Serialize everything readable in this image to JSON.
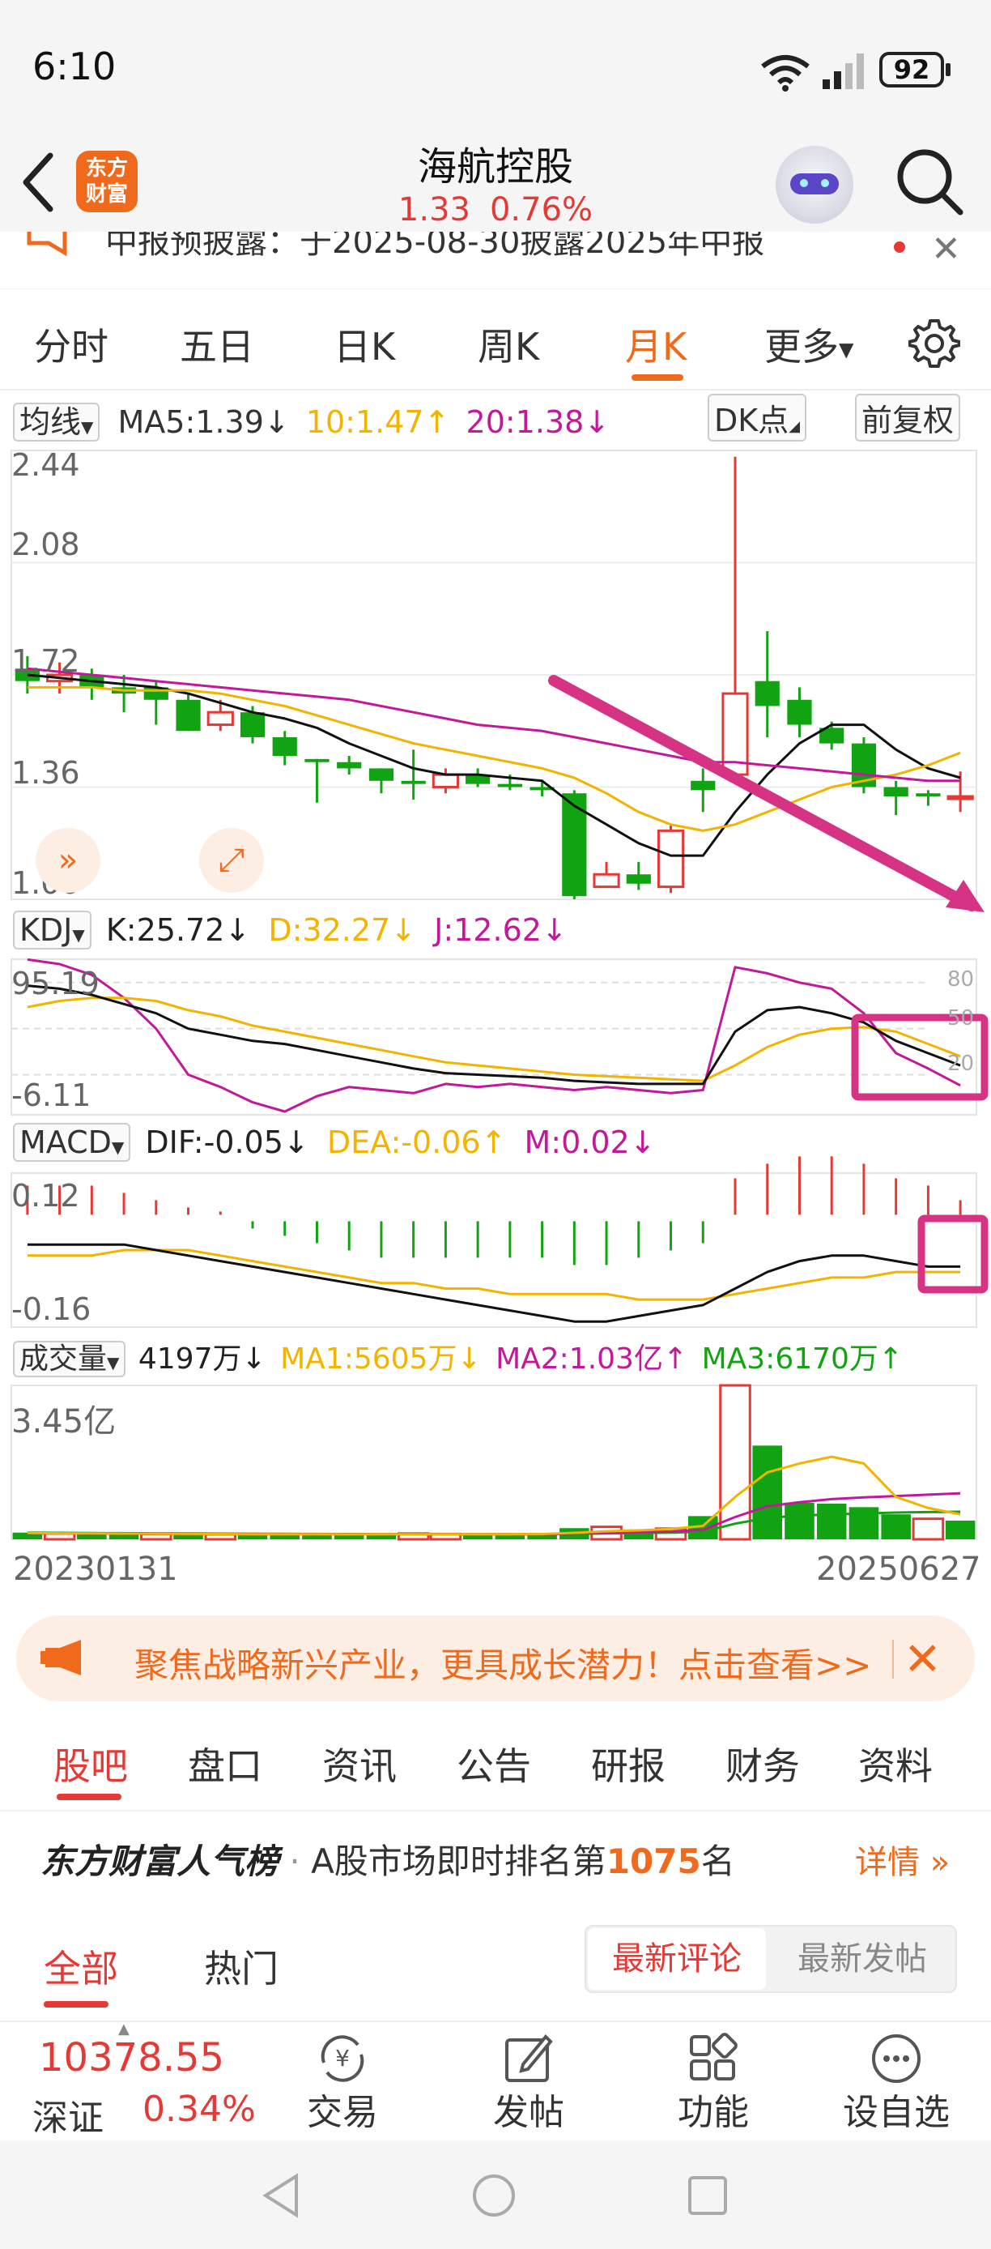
{
  "status_bar": {
    "time": "6:10",
    "battery": "92"
  },
  "header": {
    "logo_text": "东方\n财富",
    "stock_name": "海航控股",
    "price": "1.33",
    "change_pct": "0.76%"
  },
  "notice": {
    "text": "中报预披露：于2025-08-30披露2025年中报"
  },
  "period_tabs": [
    "分时",
    "五日",
    "日K",
    "周K",
    "月K",
    "更多"
  ],
  "ma_row": {
    "selector": "均线",
    "ma5": "MA5:1.39",
    "ma10": "10:1.47",
    "ma20": "20:1.38",
    "dk_button": "DK点",
    "adjust_button": "前复权"
  },
  "price_chart": {
    "y_labels": [
      "2.44",
      "2.08",
      "1.72",
      "1.36",
      "1.00"
    ]
  },
  "kdj_row": {
    "selector": "KDJ",
    "k": "K:25.72",
    "d": "D:32.27",
    "j": "J:12.62"
  },
  "kdj_chart": {
    "y_max": "95.19",
    "y_min": "-6.11",
    "right_labels": [
      "80",
      "50",
      "20"
    ]
  },
  "macd_row": {
    "selector": "MACD",
    "dif": "DIF:-0.05",
    "dea": "DEA:-0.06",
    "m": "M:0.02"
  },
  "macd_chart": {
    "y_max": "0.12",
    "y_min": "-0.16"
  },
  "vol_row": {
    "selector": "成交量",
    "vol": "4197万",
    "ma1": "MA1:5605万",
    "ma2": "MA2:1.03亿",
    "ma3": "MA3:6170万"
  },
  "vol_chart": {
    "y_max": "3.45亿"
  },
  "date_range": {
    "start": "20230131",
    "end": "20250627"
  },
  "banner": {
    "text": "聚焦战略新兴产业，更具成长潜力！点击查看>>"
  },
  "content_tabs": [
    "股吧",
    "盘口",
    "资讯",
    "公告",
    "研报",
    "财务",
    "资料"
  ],
  "popularity": {
    "brand": "东方财富人气榜",
    "prefix": "A股市场即时排名第",
    "rank": "1075",
    "suffix": "名",
    "detail": "详情"
  },
  "filter_tabs": [
    "全部",
    "热门"
  ],
  "sort_options": [
    "最新评论",
    "最新发帖"
  ],
  "bottom_index": {
    "value": "10378.55",
    "name": "深证",
    "change": "0.34%"
  },
  "bottom_bar": [
    "交易",
    "发帖",
    "功能",
    "设自选"
  ],
  "colors": {
    "up": "#e53935",
    "down": "#12a312",
    "accent": "#f06a1e",
    "ma10": "#f2b400",
    "ma20": "#c2189a",
    "annotation": "#d63384"
  },
  "chart_data": [
    {
      "type": "candlestick",
      "period": "monthly",
      "ylim": [
        1.0,
        2.44
      ],
      "candles": [
        {
          "o": 1.74,
          "c": 1.7,
          "h": 1.78,
          "l": 1.66
        },
        {
          "o": 1.7,
          "c": 1.72,
          "h": 1.76,
          "l": 1.66
        },
        {
          "o": 1.72,
          "c": 1.68,
          "h": 1.74,
          "l": 1.64
        },
        {
          "o": 1.68,
          "c": 1.66,
          "h": 1.72,
          "l": 1.6
        },
        {
          "o": 1.68,
          "c": 1.64,
          "h": 1.7,
          "l": 1.56
        },
        {
          "o": 1.64,
          "c": 1.54,
          "h": 1.66,
          "l": 1.54
        },
        {
          "o": 1.56,
          "c": 1.6,
          "h": 1.64,
          "l": 1.54
        },
        {
          "o": 1.6,
          "c": 1.52,
          "h": 1.62,
          "l": 1.5
        },
        {
          "o": 1.52,
          "c": 1.46,
          "h": 1.54,
          "l": 1.43
        },
        {
          "o": 1.45,
          "c": 1.44,
          "h": 1.45,
          "l": 1.31
        },
        {
          "o": 1.44,
          "c": 1.42,
          "h": 1.46,
          "l": 1.4
        },
        {
          "o": 1.42,
          "c": 1.38,
          "h": 1.42,
          "l": 1.34
        },
        {
          "o": 1.38,
          "c": 1.37,
          "h": 1.48,
          "l": 1.32
        },
        {
          "o": 1.36,
          "c": 1.4,
          "h": 1.42,
          "l": 1.34
        },
        {
          "o": 1.4,
          "c": 1.37,
          "h": 1.42,
          "l": 1.36
        },
        {
          "o": 1.37,
          "c": 1.36,
          "h": 1.4,
          "l": 1.35
        },
        {
          "o": 1.36,
          "c": 1.35,
          "h": 1.38,
          "l": 1.33
        },
        {
          "o": 1.34,
          "c": 1.01,
          "h": 1.35,
          "l": 1.0
        },
        {
          "o": 1.04,
          "c": 1.08,
          "h": 1.12,
          "l": 1.04
        },
        {
          "o": 1.08,
          "c": 1.05,
          "h": 1.12,
          "l": 1.03
        },
        {
          "o": 1.04,
          "c": 1.22,
          "h": 1.24,
          "l": 1.02
        },
        {
          "o": 1.38,
          "c": 1.35,
          "h": 1.42,
          "l": 1.28
        },
        {
          "o": 1.4,
          "c": 1.66,
          "h": 2.42,
          "l": 1.38
        },
        {
          "o": 1.7,
          "c": 1.62,
          "h": 1.86,
          "l": 1.52
        },
        {
          "o": 1.64,
          "c": 1.56,
          "h": 1.68,
          "l": 1.52
        },
        {
          "o": 1.55,
          "c": 1.5,
          "h": 1.57,
          "l": 1.48
        },
        {
          "o": 1.5,
          "c": 1.36,
          "h": 1.52,
          "l": 1.34
        },
        {
          "o": 1.36,
          "c": 1.33,
          "h": 1.38,
          "l": 1.27
        },
        {
          "o": 1.34,
          "c": 1.33,
          "h": 1.35,
          "l": 1.3
        },
        {
          "o": 1.33,
          "c": 1.33,
          "h": 1.41,
          "l": 1.28
        }
      ],
      "ma5": [
        1.72,
        1.71,
        1.7,
        1.69,
        1.68,
        1.66,
        1.63,
        1.6,
        1.58,
        1.55,
        1.5,
        1.46,
        1.42,
        1.4,
        1.4,
        1.39,
        1.38,
        1.3,
        1.24,
        1.18,
        1.14,
        1.14,
        1.28,
        1.4,
        1.5,
        1.56,
        1.56,
        1.48,
        1.42,
        1.39
      ],
      "ma10": [
        1.68,
        1.68,
        1.68,
        1.67,
        1.67,
        1.67,
        1.66,
        1.64,
        1.62,
        1.59,
        1.56,
        1.53,
        1.5,
        1.48,
        1.46,
        1.44,
        1.42,
        1.39,
        1.34,
        1.28,
        1.24,
        1.22,
        1.24,
        1.28,
        1.32,
        1.36,
        1.38,
        1.4,
        1.43,
        1.47
      ],
      "ma20": [
        1.74,
        1.73,
        1.72,
        1.71,
        1.7,
        1.69,
        1.68,
        1.67,
        1.66,
        1.65,
        1.64,
        1.62,
        1.6,
        1.58,
        1.56,
        1.55,
        1.54,
        1.52,
        1.5,
        1.48,
        1.46,
        1.44,
        1.44,
        1.43,
        1.42,
        1.41,
        1.4,
        1.39,
        1.38,
        1.38
      ]
    },
    {
      "type": "line",
      "name": "KDJ",
      "ylim": [
        -6.11,
        95.19
      ],
      "K": [
        78,
        76,
        72,
        66,
        60,
        50,
        46,
        42,
        40,
        36,
        32,
        28,
        24,
        21,
        20,
        19,
        18,
        16,
        15,
        14,
        14,
        14,
        48,
        62,
        64,
        60,
        54,
        42,
        34,
        26
      ],
      "D": [
        64,
        68,
        70,
        70,
        68,
        62,
        58,
        52,
        48,
        44,
        40,
        36,
        32,
        28,
        26,
        24,
        22,
        20,
        19,
        18,
        17,
        16,
        26,
        38,
        46,
        50,
        51,
        48,
        40,
        32
      ],
      "J": [
        95,
        92,
        85,
        70,
        50,
        20,
        12,
        2,
        -4,
        6,
        12,
        10,
        8,
        14,
        12,
        14,
        12,
        10,
        12,
        10,
        8,
        10,
        90,
        86,
        80,
        76,
        60,
        34,
        24,
        13
      ]
    },
    {
      "type": "bar+line",
      "name": "MACD",
      "ylim": [
        -0.16,
        0.12
      ],
      "hist": [
        0.04,
        0.04,
        0.04,
        0.03,
        0.02,
        0.01,
        0.0,
        -0.01,
        -0.02,
        -0.03,
        -0.04,
        -0.05,
        -0.05,
        -0.05,
        -0.05,
        -0.05,
        -0.05,
        -0.06,
        -0.06,
        -0.05,
        -0.04,
        -0.03,
        0.05,
        0.07,
        0.08,
        0.08,
        0.07,
        0.05,
        0.04,
        0.02
      ],
      "DIF": [
        -0.01,
        -0.01,
        -0.01,
        -0.01,
        -0.02,
        -0.03,
        -0.04,
        -0.05,
        -0.06,
        -0.07,
        -0.08,
        -0.09,
        -0.1,
        -0.11,
        -0.12,
        -0.13,
        -0.14,
        -0.15,
        -0.15,
        -0.14,
        -0.13,
        -0.12,
        -0.09,
        -0.06,
        -0.04,
        -0.03,
        -0.03,
        -0.04,
        -0.05,
        -0.05
      ],
      "DEA": [
        -0.03,
        -0.03,
        -0.03,
        -0.02,
        -0.02,
        -0.02,
        -0.03,
        -0.04,
        -0.05,
        -0.06,
        -0.07,
        -0.08,
        -0.08,
        -0.09,
        -0.09,
        -0.1,
        -0.1,
        -0.1,
        -0.1,
        -0.11,
        -0.11,
        -0.11,
        -0.1,
        -0.09,
        -0.08,
        -0.07,
        -0.07,
        -0.06,
        -0.06,
        -0.06
      ]
    },
    {
      "type": "bar+line",
      "name": "成交量",
      "unit": "万",
      "ylim": [
        0,
        34500
      ],
      "volumes": [
        1500,
        1300,
        1200,
        1100,
        1200,
        1200,
        1100,
        1100,
        1100,
        1100,
        1100,
        1200,
        1300,
        1200,
        1100,
        1100,
        1200,
        2500,
        2800,
        2200,
        2400,
        5200,
        34500,
        21000,
        8200,
        8000,
        7200,
        5600,
        4600,
        4197
      ],
      "up": [
        false,
        true,
        false,
        false,
        true,
        false,
        true,
        false,
        false,
        false,
        false,
        false,
        true,
        true,
        false,
        false,
        false,
        false,
        true,
        false,
        true,
        false,
        true,
        false,
        false,
        false,
        false,
        false,
        true,
        false
      ],
      "MA1": [
        1400,
        1350,
        1300,
        1280,
        1250,
        1200,
        1180,
        1150,
        1130,
        1120,
        1110,
        1120,
        1140,
        1150,
        1150,
        1150,
        1180,
        1450,
        1800,
        2000,
        2300,
        3000,
        9500,
        15000,
        17000,
        18500,
        17000,
        9500,
        7000,
        5605
      ],
      "MA2": [
        1300,
        1300,
        1280,
        1260,
        1240,
        1220,
        1200,
        1180,
        1160,
        1150,
        1140,
        1140,
        1140,
        1140,
        1140,
        1140,
        1150,
        1300,
        1450,
        1600,
        1750,
        2100,
        5000,
        7400,
        8300,
        9000,
        9400,
        9700,
        10000,
        10300
      ],
      "MA3": [
        1500,
        1450,
        1400,
        1380,
        1350,
        1300,
        1280,
        1250,
        1230,
        1200,
        1180,
        1170,
        1160,
        1150,
        1150,
        1150,
        1150,
        1200,
        1300,
        1400,
        1500,
        1700,
        3500,
        4800,
        5300,
        5600,
        5800,
        6000,
        6100,
        6170
      ]
    }
  ]
}
